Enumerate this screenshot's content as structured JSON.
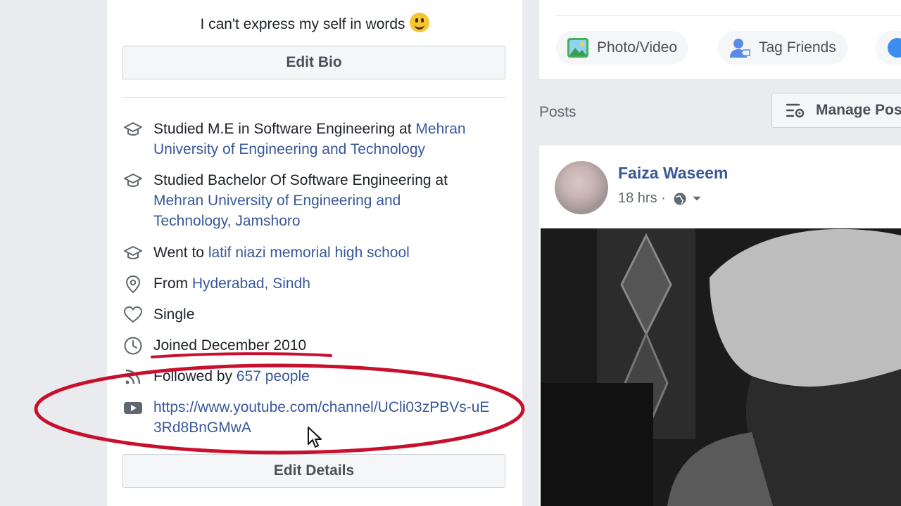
{
  "intro": {
    "bio": "I can't express my self in words",
    "edit_bio": "Edit Bio",
    "items": [
      {
        "icon": "graduation-cap-icon",
        "text": "Studied M.E in Software Engineering at ",
        "link": "Mehran University of Engineering and Technology"
      },
      {
        "icon": "graduation-cap-icon",
        "text": "Studied Bachelor Of Software Engineering at ",
        "link": "Mehran University of Engineering and Technology, Jamshoro"
      },
      {
        "icon": "graduation-cap-icon",
        "text": "Went to ",
        "link": "latif niazi memorial high school"
      },
      {
        "icon": "location-pin-icon",
        "text": "From ",
        "link": "Hyderabad, Sindh"
      },
      {
        "icon": "heart-icon",
        "text": "Single",
        "link": ""
      },
      {
        "icon": "clock-icon",
        "text": "Joined December 2010",
        "link": ""
      },
      {
        "icon": "rss-icon",
        "text": "Followed by ",
        "link": "657 people"
      },
      {
        "icon": "youtube-icon",
        "text": "",
        "link": "https://www.youtube.com/channel/UCli03zPBVs-uE3Rd8BnGMwA"
      }
    ],
    "edit_details": "Edit Details"
  },
  "composer": {
    "photo_video": "Photo/Video",
    "tag_friends": "Tag Friends"
  },
  "posts": {
    "label": "Posts",
    "manage": "Manage Posts",
    "author": "Faiza Waseem",
    "time": "18 hrs ·",
    "privacy_icon": "globe-icon"
  },
  "colors": {
    "link": "#385898",
    "annotation": "#c8102e"
  }
}
